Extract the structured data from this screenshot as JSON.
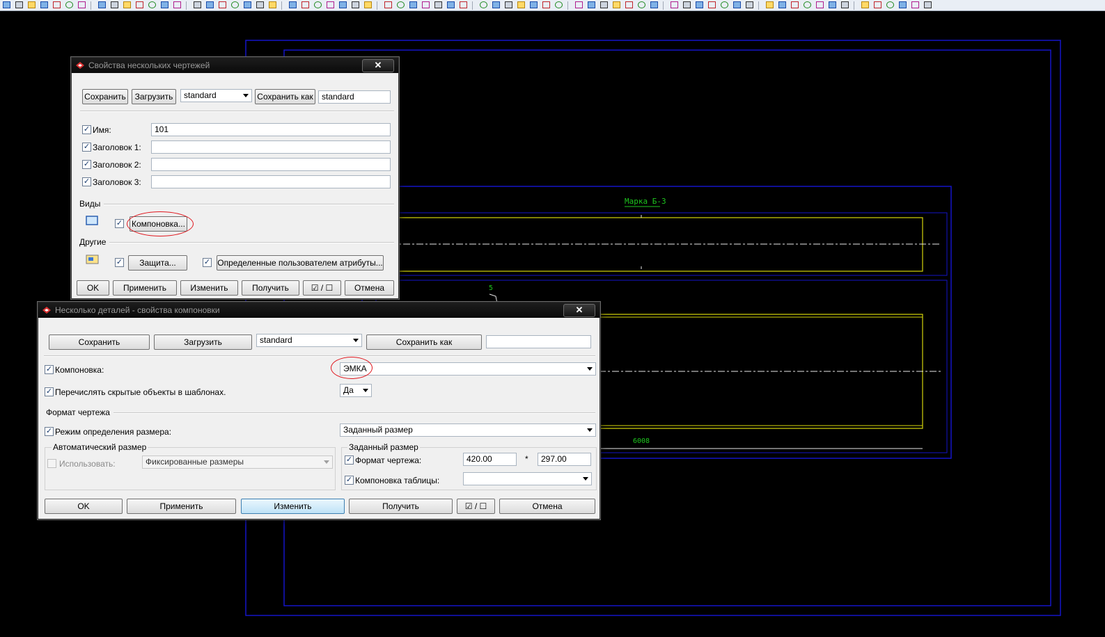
{
  "toolbar": {
    "icons": [
      "save-icon",
      "save-all-icon",
      "export-icon",
      "print-icon",
      "undo-icon",
      "redo-icon",
      "select-icon",
      "open-icon",
      "view-icon",
      "zoom-icon",
      "snap-icon",
      "measure-icon",
      "next-icon",
      "help-icon",
      "dimension-icon",
      "line-icon",
      "circle-icon",
      "polyline-icon"
    ]
  },
  "cad": {
    "mark_label": "Марка Б-3",
    "small_label": "5",
    "dim_label": "6008"
  },
  "dialog1": {
    "title": "Свойства нескольких чертежей",
    "save_button": "Сохранить",
    "load_button": "Загрузить",
    "preset_value": "standard",
    "save_as_button": "Сохранить как",
    "save_as_value": "standard",
    "name_label": "Имя:",
    "name_value": "101",
    "header1_label": "Заголовок 1:",
    "header1_value": "",
    "header2_label": "Заголовок 2:",
    "header2_value": "",
    "header3_label": "Заголовок 3:",
    "header3_value": "",
    "views_section": "Виды",
    "layout_button": "Компоновка...",
    "other_section": "Другие",
    "protection_button": "Защита...",
    "user_attrs_button": "Определенные пользователем атрибуты...",
    "ok_button": "OK",
    "apply_button": "Применить",
    "modify_button": "Изменить",
    "get_button": "Получить",
    "toggle_button": "☑ / ☐",
    "cancel_button": "Отмена"
  },
  "dialog2": {
    "title": "Несколько деталей - свойства компоновки",
    "save_button": "Сохранить",
    "load_button": "Загрузить",
    "preset_value": "standard",
    "save_as_button": "Сохранить как",
    "save_as_value": "",
    "layout_label": "Компоновка:",
    "layout_value": "ЭМКА",
    "list_hidden_label": "Перечислять скрытые объекты в шаблонах.",
    "list_hidden_value": "Да",
    "format_section": "Формат чертежа",
    "size_mode_label": "Режим определения размера:",
    "size_mode_value": "Заданный размер",
    "auto_size_group": "Автоматический размер",
    "use_label": "Использовать:",
    "use_value": "Фиксированные размеры",
    "given_size_group": "Заданный размер",
    "sheet_format_label": "Формат чертежа:",
    "width_value": "420.00",
    "times_sign": "*",
    "height_value": "297.00",
    "table_layout_label": "Компоновка таблицы:",
    "table_layout_value": "",
    "ok_button": "OK",
    "apply_button": "Применить",
    "modify_button": "Изменить",
    "get_button": "Получить",
    "toggle_button": "☑ / ☐",
    "cancel_button": "Отмена"
  },
  "colors": {
    "frame": "#1414c8",
    "beam": "#d6d60a",
    "label_green": "#1ec61e",
    "annotation_red": "#e0161d"
  }
}
